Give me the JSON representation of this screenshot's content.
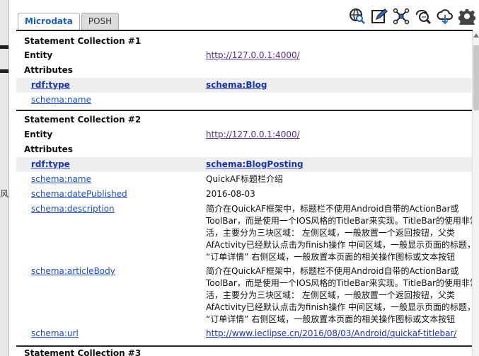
{
  "tabs": [
    {
      "label": "Microdata",
      "active": true
    },
    {
      "label": "POSH",
      "active": false
    }
  ],
  "toolbar": {
    "icons": [
      "globe-search-icon",
      "edit-icon",
      "graph-icon",
      "search-icon",
      "cloud-download-icon",
      "gear-icon"
    ]
  },
  "background_text": "风",
  "collections": [
    {
      "title": "Statement Collection #1",
      "entity_label": "Entity",
      "entity_value": "http://127.0.0.1:4000/",
      "attributes_label": "Attributes",
      "type_pred": "rdf:type",
      "type_value": "schema:Blog",
      "attributes": [
        {
          "pred": "schema:name",
          "value": ""
        }
      ]
    },
    {
      "title": "Statement Collection #2",
      "entity_label": "Entity",
      "entity_value": "http://127.0.0.1:4000/",
      "attributes_label": "Attributes",
      "type_pred": "rdf:type",
      "type_value": "schema:BlogPosting",
      "attributes": [
        {
          "pred": "schema:name",
          "value": "QuickAF标题栏介绍"
        },
        {
          "pred": "schema:datePublished",
          "value": "2016-08-03"
        },
        {
          "pred": "schema:description",
          "lines": [
            "简介在QuickAF框架中，标题栏不使用Android自带的ActionBar或",
            "ToolBar，而是使用一个IOS风格的TitleBar来实现。TitleBar的使用非常",
            "活，主要分为三块区域： 左侧区域，一般放置一个返回按钮，父类",
            "AfActivity已经默认点击为finish操作 中间区域，一般显示页面的标题，",
            "“订单详情” 右侧区域，一般放置本页面的相关操作图标或文本按钮"
          ]
        },
        {
          "pred": "schema:articleBody",
          "lines": [
            "简介在QuickAF框架中，标题栏不使用Android自带的ActionBar或",
            "ToolBar，而是使用一个IOS风格的TitleBar来实现。TitleBar的使用非常",
            "活，主要分为三块区域： 左侧区域，一般放置一个返回按钮，父类",
            "AfActivity已经默认点击为finish操作 中间区域，一般显示页面的标题，",
            "“订单详情” 右侧区域，一般放置本页面的相关操作图标或文本按钮"
          ]
        },
        {
          "pred": "schema:url",
          "value": "http://www.ieclipse.cn/2016/08/03/Android/quickaf-titlebar/",
          "is_link": true
        }
      ]
    },
    {
      "title": "Statement Collection #3"
    }
  ]
}
